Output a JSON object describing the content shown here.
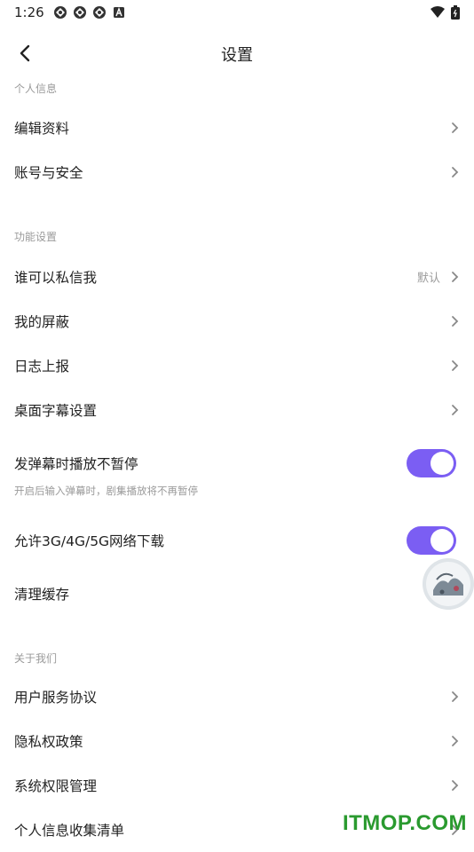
{
  "status": {
    "time": "1:26"
  },
  "header": {
    "title": "设置"
  },
  "sections": {
    "personal": {
      "title": "个人信息",
      "items": [
        {
          "label": "编辑资料"
        },
        {
          "label": "账号与安全"
        }
      ]
    },
    "features": {
      "title": "功能设置",
      "items": [
        {
          "label": "谁可以私信我",
          "value": "默认"
        },
        {
          "label": "我的屏蔽"
        },
        {
          "label": "日志上报"
        },
        {
          "label": "桌面字幕设置"
        }
      ],
      "toggle_danmaku": {
        "label": "发弹幕时播放不暂停",
        "sub": "开启后输入弹幕时，剧集播放将不再暂停",
        "on": true
      },
      "toggle_network": {
        "label": "允许3G/4G/5G网络下载",
        "on": true
      },
      "cache": {
        "label": "清理缓存"
      }
    },
    "about": {
      "title": "关于我们",
      "items": [
        {
          "label": "用户服务协议"
        },
        {
          "label": "隐私权政策"
        },
        {
          "label": "系统权限管理"
        },
        {
          "label": "个人信息收集清单"
        }
      ]
    }
  },
  "watermark": "ITMOP.COM",
  "colors": {
    "accent": "#7b5ef3",
    "watermark": "#2a9a2f"
  }
}
